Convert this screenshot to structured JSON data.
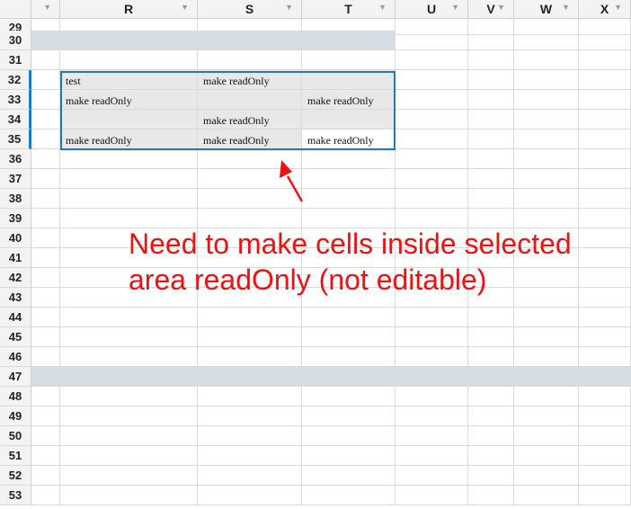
{
  "columns": [
    {
      "label": "",
      "filter_icon": "filter-icon"
    },
    {
      "label": "R",
      "filter_icon": "filter-icon"
    },
    {
      "label": "S",
      "filter_icon": "filter-icon"
    },
    {
      "label": "T",
      "filter_icon": "filter-icon"
    },
    {
      "label": "U",
      "filter_icon": "filter-icon"
    },
    {
      "label": "V",
      "filter_icon": "filter-icon"
    },
    {
      "label": "W",
      "filter_icon": "filter-icon"
    },
    {
      "label": "X",
      "filter_icon": "filter-icon"
    }
  ],
  "rows": [
    {
      "num": "29",
      "cells": [
        "",
        "",
        "",
        "",
        "",
        "",
        "",
        ""
      ]
    },
    {
      "num": "30",
      "cells": [
        "",
        "",
        "",
        "",
        "",
        "",
        "",
        ""
      ]
    },
    {
      "num": "31",
      "cells": [
        "",
        "",
        "",
        "",
        "",
        "",
        "",
        ""
      ]
    },
    {
      "num": "32",
      "cells": [
        "",
        "test",
        "make readOnly",
        "",
        "",
        "",
        "",
        ""
      ]
    },
    {
      "num": "33",
      "cells": [
        "",
        "make readOnly",
        "",
        "make readOnly",
        "",
        "",
        "",
        ""
      ]
    },
    {
      "num": "34",
      "cells": [
        "",
        "",
        "make readOnly",
        "",
        "",
        "",
        "",
        ""
      ]
    },
    {
      "num": "35",
      "cells": [
        "",
        "make readOnly",
        "make readOnly",
        "make readOnly",
        "",
        "",
        "",
        ""
      ]
    },
    {
      "num": "36",
      "cells": [
        "",
        "",
        "",
        "",
        "",
        "",
        "",
        ""
      ]
    },
    {
      "num": "37",
      "cells": [
        "",
        "",
        "",
        "",
        "",
        "",
        "",
        ""
      ]
    },
    {
      "num": "38",
      "cells": [
        "",
        "",
        "",
        "",
        "",
        "",
        "",
        ""
      ]
    },
    {
      "num": "39",
      "cells": [
        "",
        "",
        "",
        "",
        "",
        "",
        "",
        ""
      ]
    },
    {
      "num": "40",
      "cells": [
        "",
        "",
        "",
        "",
        "",
        "",
        "",
        ""
      ]
    },
    {
      "num": "41",
      "cells": [
        "",
        "",
        "",
        "",
        "",
        "",
        "",
        ""
      ]
    },
    {
      "num": "42",
      "cells": [
        "",
        "",
        "",
        "",
        "",
        "",
        "",
        ""
      ]
    },
    {
      "num": "43",
      "cells": [
        "",
        "",
        "",
        "",
        "",
        "",
        "",
        ""
      ]
    },
    {
      "num": "44",
      "cells": [
        "",
        "",
        "",
        "",
        "",
        "",
        "",
        ""
      ]
    },
    {
      "num": "45",
      "cells": [
        "",
        "",
        "",
        "",
        "",
        "",
        "",
        ""
      ]
    },
    {
      "num": "46",
      "cells": [
        "",
        "",
        "",
        "",
        "",
        "",
        "",
        ""
      ]
    },
    {
      "num": "47",
      "cells": [
        "",
        "",
        "",
        "",
        "",
        "",
        "",
        ""
      ]
    },
    {
      "num": "48",
      "cells": [
        "",
        "",
        "",
        "",
        "",
        "",
        "",
        ""
      ]
    },
    {
      "num": "49",
      "cells": [
        "",
        "",
        "",
        "",
        "",
        "",
        "",
        ""
      ]
    },
    {
      "num": "50",
      "cells": [
        "",
        "",
        "",
        "",
        "",
        "",
        "",
        ""
      ]
    },
    {
      "num": "51",
      "cells": [
        "",
        "",
        "",
        "",
        "",
        "",
        "",
        ""
      ]
    },
    {
      "num": "52",
      "cells": [
        "",
        "",
        "",
        "",
        "",
        "",
        "",
        ""
      ]
    },
    {
      "num": "53",
      "cells": [
        "",
        "",
        "",
        "",
        "",
        "",
        "",
        ""
      ]
    }
  ],
  "selection": {
    "range": "R32:T35",
    "rows": [
      "32",
      "33",
      "34",
      "35"
    ]
  },
  "annotation": {
    "line1": "Need to make cells inside selected",
    "line2": "area readOnly (not editable)",
    "color": "#ee1111"
  },
  "colors": {
    "header_bg": "#f3f3f3",
    "band_bg": "#d6dde4",
    "readonly_bg": "#e8e8e8",
    "selection_border": "#1f7ab8"
  }
}
